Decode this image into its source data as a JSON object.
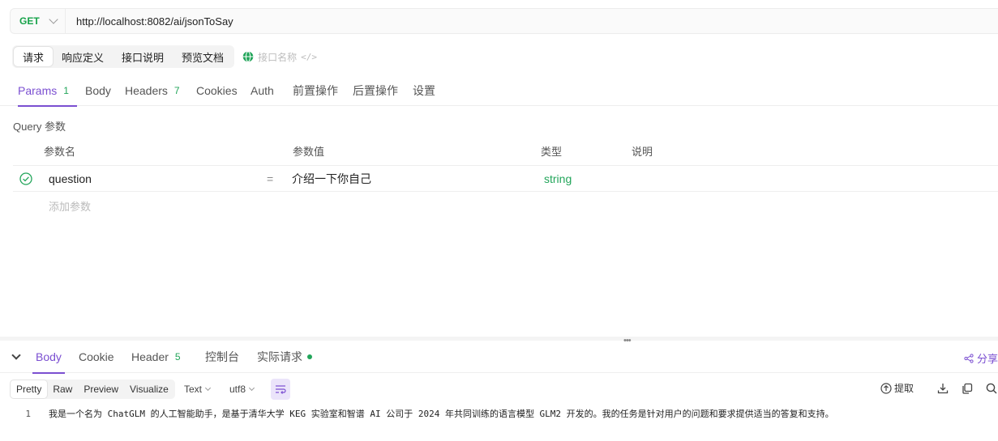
{
  "url_bar": {
    "method": "GET",
    "url": "http://localhost:8082/ai/jsonToSay"
  },
  "request_tabs": [
    "请求",
    "响应定义",
    "接口说明",
    "预览文档"
  ],
  "api_name_placeholder": "接口名称",
  "params_tabs": [
    {
      "label": "Params",
      "count": "1"
    },
    {
      "label": "Body",
      "count": ""
    },
    {
      "label": "Headers",
      "count": "7"
    },
    {
      "label": "Cookies",
      "count": ""
    },
    {
      "label": "Auth",
      "count": ""
    },
    {
      "label": "前置操作",
      "count": ""
    },
    {
      "label": "后置操作",
      "count": ""
    },
    {
      "label": "设置",
      "count": ""
    }
  ],
  "query": {
    "label": "Query 参数",
    "columns": [
      "参数名",
      "参数值",
      "类型",
      "说明"
    ],
    "rows": [
      {
        "name": "question",
        "op": "=",
        "value": "介绍一下你自己",
        "type": "string",
        "desc": ""
      }
    ],
    "add_placeholder": "添加参数"
  },
  "response_tabs": [
    {
      "label": "Body",
      "count": ""
    },
    {
      "label": "Cookie",
      "count": ""
    },
    {
      "label": "Header",
      "count": "5"
    },
    {
      "label": "控制台",
      "count": ""
    },
    {
      "label": "实际请求",
      "count": ""
    }
  ],
  "share_label": "分享",
  "view_modes": [
    "Pretty",
    "Raw",
    "Preview",
    "Visualize"
  ],
  "format_select": "Text",
  "encoding_select": "utf8",
  "extract_label": "提取",
  "response_body": {
    "line_no": "1",
    "text": "我是一个名为 ChatGLM 的人工智能助手，是基于清华大学 KEG 实验室和智谱 AI 公司于 2024 年共同训练的语言模型 GLM2 开发的。我的任务是针对用户的问题和要求提供适当的答复和支持。"
  },
  "colors": {
    "accent": "#7b4fd1",
    "success": "#22a55a"
  },
  "icons": [
    "chevron-down-icon",
    "globe-icon",
    "code-icon",
    "check-circle-icon",
    "share-icon",
    "wrap-lines-icon",
    "extract-icon",
    "download-icon",
    "copy-icon",
    "search-icon"
  ]
}
